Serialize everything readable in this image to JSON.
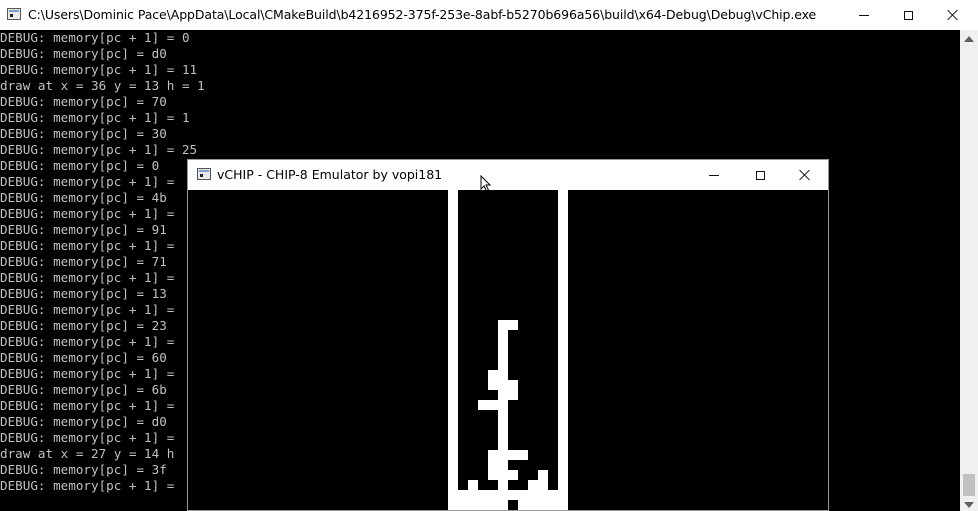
{
  "console": {
    "title": "C:\\Users\\Dominic Pace\\AppData\\Local\\CMakeBuild\\b4216952-375f-253e-8abf-b5270b696a56\\build\\x64-Debug\\Debug\\vChip.exe",
    "lines": [
      "DEBUG: memory[pc + 1] = 0",
      "DEBUG: memory[pc] = d0",
      "DEBUG: memory[pc + 1] = 11",
      "draw at x = 36 y = 13 h = 1",
      "DEBUG: memory[pc] = 70",
      "DEBUG: memory[pc + 1] = 1",
      "DEBUG: memory[pc] = 30",
      "DEBUG: memory[pc + 1] = 25",
      "DEBUG: memory[pc] = 0",
      "DEBUG: memory[pc + 1] =",
      "DEBUG: memory[pc] = 4b",
      "DEBUG: memory[pc + 1] =",
      "DEBUG: memory[pc] = 91",
      "DEBUG: memory[pc + 1] =",
      "DEBUG: memory[pc] = 71",
      "DEBUG: memory[pc + 1] =",
      "DEBUG: memory[pc] = 13",
      "DEBUG: memory[pc + 1] =",
      "DEBUG: memory[pc] = 23",
      "DEBUG: memory[pc + 1] =",
      "DEBUG: memory[pc] = 60",
      "DEBUG: memory[pc + 1] =",
      "DEBUG: memory[pc] = 6b",
      "DEBUG: memory[pc + 1] =",
      "DEBUG: memory[pc] = d0",
      "DEBUG: memory[pc + 1] =",
      "draw at x = 27 y = 14 h",
      "DEBUG: memory[pc] = 3f",
      "DEBUG: memory[pc + 1] ="
    ]
  },
  "emulator": {
    "title": "vCHIP - CHIP-8 Emulator by vopi181"
  },
  "colors": {
    "console_bg": "#000000",
    "console_text": "#c0c0c0",
    "titlebar_bg": "#ffffff",
    "pixel_on": "#ffffff",
    "pixel_off": "#000000"
  },
  "icons": {
    "minimize": "minimize-icon",
    "maximize": "maximize-icon",
    "close": "close-icon",
    "app": "console-app-icon"
  }
}
